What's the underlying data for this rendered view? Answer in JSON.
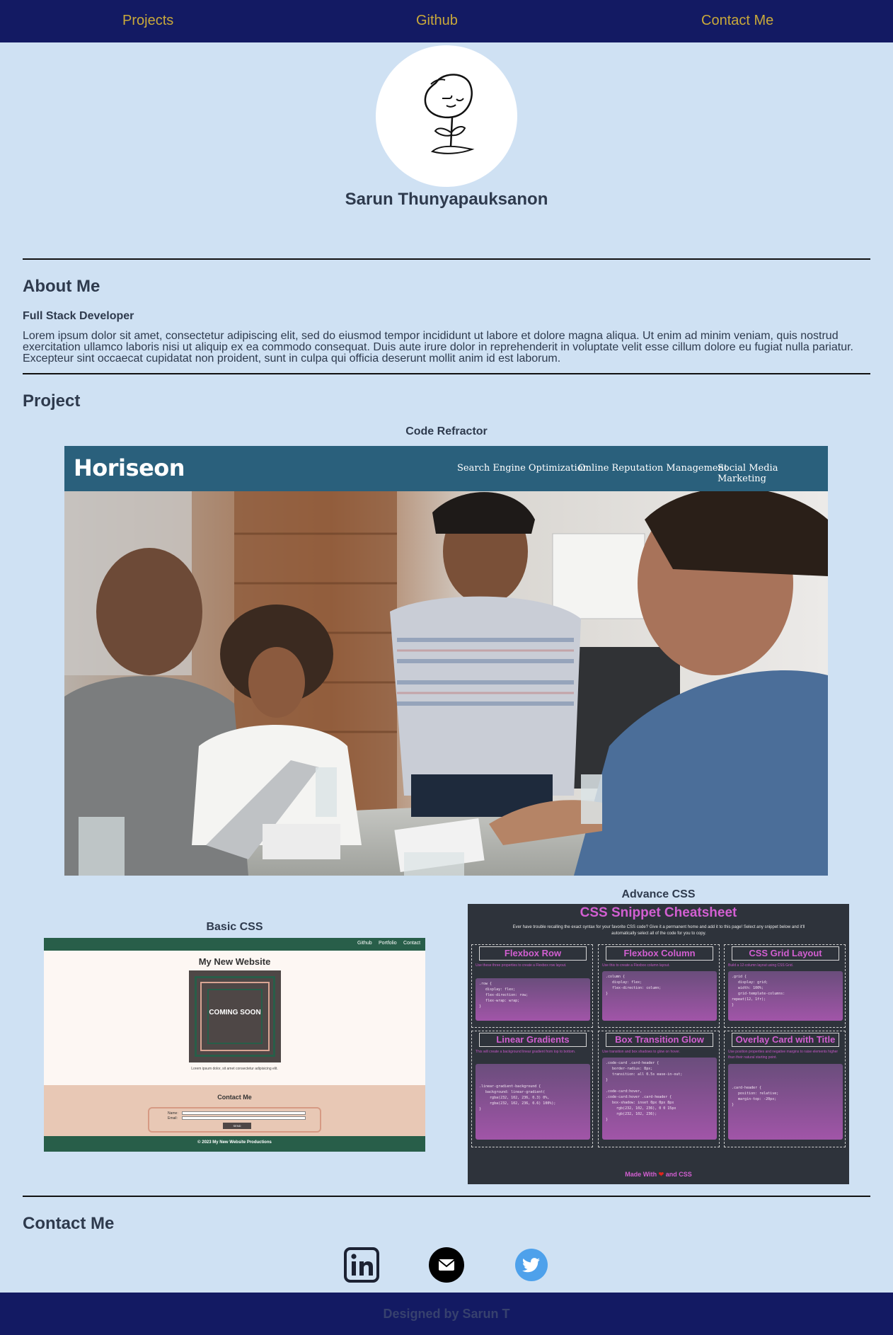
{
  "nav": {
    "items": [
      {
        "label": "Projects"
      },
      {
        "label": "Github"
      },
      {
        "label": "Contact Me"
      }
    ]
  },
  "hero": {
    "name": "Sarun Thunyapauksanon"
  },
  "about": {
    "heading": "About Me",
    "role": "Full Stack Developer",
    "bio": "Lorem ipsum dolor sit amet, consectetur adipiscing elit, sed do eiusmod tempor incididunt ut labore et dolore magna aliqua. Ut enim ad minim veniam, quis nostrud exercitation ullamco laboris nisi ut aliquip ex ea commodo consequat. Duis aute irure dolor in reprehenderit in voluptate velit esse cillum dolore eu fugiat nulla pariatur. Excepteur sint occaecat cupidatat non proident, sunt in culpa qui officia deserunt mollit anim id est laborum."
  },
  "project": {
    "heading": "Project",
    "items": [
      {
        "title": "Code Refractor",
        "preview": {
          "logo": "Horiseon",
          "nav": [
            "Search Engine Optimization",
            "Online Reputation Management",
            "Social Media Marketing"
          ]
        }
      },
      {
        "title": "Basic CSS",
        "preview": {
          "nav": [
            "Github",
            "Portfolio",
            "Contact"
          ],
          "title": "My New Website",
          "badge": "COMING SOON",
          "lorem": "Lorem ipsum dolor, sit amet consectetur adipisicing elit.",
          "contact_title": "Contact Me",
          "name_label": "Name:",
          "email_label": "Email:",
          "send_label": "SEND",
          "footer": "© 2023 My New Website Productions"
        }
      },
      {
        "title": "Advance CSS",
        "preview": {
          "title": "CSS Snippet Cheatsheet",
          "subtitle": "Ever have trouble recalling the exact syntax for your favorite CSS code? Give it a permanent home and add it to this page! Select any snippet below and it'll automatically select all of the code for you to copy.",
          "cards": [
            {
              "title": "Flexbox Row",
              "desc": "Use these three properties to create a Flexbox row layout.",
              "code": ".row {\n   display: flex;\n   flex-direction: row;\n   flex-wrap: wrap;\n}"
            },
            {
              "title": "Flexbox Column",
              "desc": "Use this to create a Flexbox column layout.",
              "code": ".column {\n   display: flex;\n   flex-direction: column;\n}"
            },
            {
              "title": "CSS Grid Layout",
              "desc": "Build a 12-column layout using CSS Grid.",
              "code": ".grid {\n   display: grid;\n   width: 100%;\n   grid-template-columns:\nrepeat(12, 1fr);\n}"
            },
            {
              "title": "Linear Gradients",
              "desc": "This will create a background linear gradient from top to bottom.",
              "code": ".linear-gradient-background {\n   background: linear-gradient(\n     rgba(232, 102, 236, 0.3) 0%,\n     rgba(232, 102, 236, 0.6) 100%);\n}"
            },
            {
              "title": "Box Transition Glow",
              "desc": "Use transition and box shadows to glow on hover.",
              "code": ".code-card .card-header {\n   border-radius: 8px;\n   transition: all 0.5s ease-in-out;\n}\n\n.code-card:hover,\n.code-card:hover .card-header {\n   box-shadow: inset 0px 0px 8px\n     rgb(232, 102, 236), 0 0 15px\n     rgb(232, 102, 236);\n}"
            },
            {
              "title": "Overlay Card with Title",
              "desc": "Use position properties and negative margins to raise elements higher than their natural starting point.",
              "code": ".card-header {\n   position: relative;\n   margin-top: -20px;\n}"
            }
          ],
          "made_with_prefix": "Made With",
          "made_with_suffix": "and CSS"
        }
      }
    ]
  },
  "contact": {
    "heading": "Contact Me",
    "icons": [
      "linkedin-icon",
      "email-icon",
      "twitter-icon"
    ]
  },
  "footer": {
    "text": "Designed by Sarun T"
  },
  "colors": {
    "page_bg": "#cfe1f3",
    "nav_bg": "#131a63",
    "nav_link": "#c9a93a",
    "heading": "#2e3a4d",
    "twitter": "#4ea1eb",
    "cheatsheet_accent": "#d25fd1"
  }
}
